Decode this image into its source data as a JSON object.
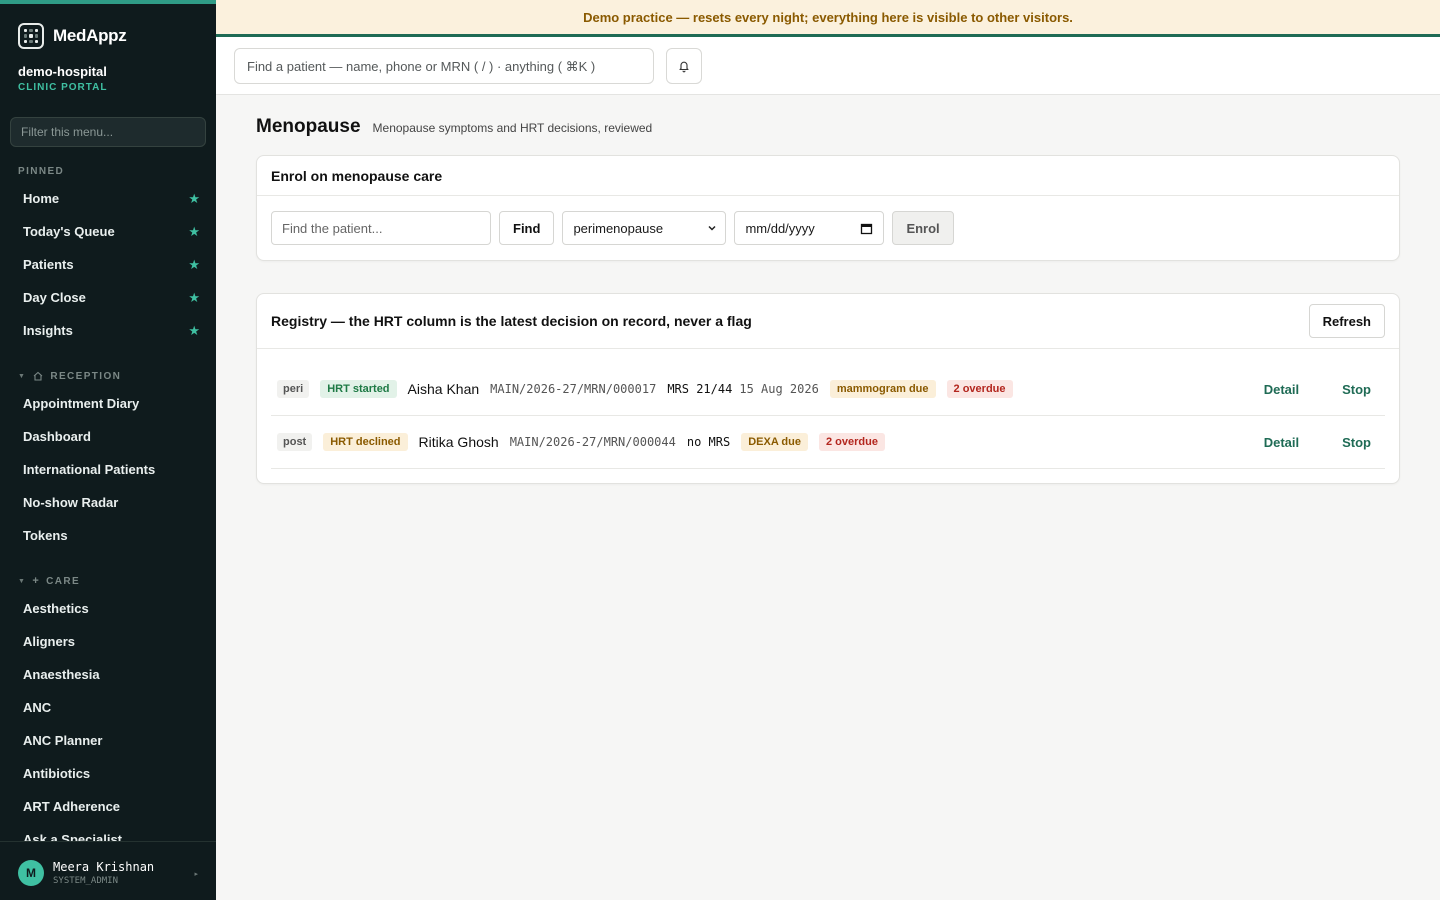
{
  "brand": {
    "name": "MedAppz"
  },
  "org": {
    "name": "demo-hospital",
    "sub": "CLINIC PORTAL"
  },
  "sidebar": {
    "filter_placeholder": "Filter this menu...",
    "pinned_label": "PINNED",
    "pinned": [
      {
        "label": "Home"
      },
      {
        "label": "Today's Queue"
      },
      {
        "label": "Patients"
      },
      {
        "label": "Day Close"
      },
      {
        "label": "Insights"
      }
    ],
    "reception_label": "RECEPTION",
    "reception": [
      {
        "label": "Appointment Diary"
      },
      {
        "label": "Dashboard"
      },
      {
        "label": "International Patients"
      },
      {
        "label": "No-show Radar"
      },
      {
        "label": "Tokens"
      }
    ],
    "care_label": "CARE",
    "care": [
      {
        "label": "Aesthetics"
      },
      {
        "label": "Aligners"
      },
      {
        "label": "Anaesthesia"
      },
      {
        "label": "ANC"
      },
      {
        "label": "ANC Planner"
      },
      {
        "label": "Antibiotics"
      },
      {
        "label": "ART Adherence"
      },
      {
        "label": "Ask a Specialist"
      }
    ]
  },
  "user": {
    "initial": "M",
    "name": "Meera Krishnan",
    "role": "SYSTEM_ADMIN"
  },
  "banner": {
    "text": "Demo practice — resets every night; everything here is visible to other visitors."
  },
  "topbar": {
    "search_placeholder": "Find a patient — name, phone or MRN ( / ) · anything ( ⌘K )"
  },
  "page": {
    "title": "Menopause",
    "subtitle": "Menopause symptoms and HRT decisions, reviewed"
  },
  "enrol": {
    "title": "Enrol on menopause care",
    "patient_placeholder": "Find the patient...",
    "find_label": "Find",
    "stage_value": "perimenopause",
    "date_placeholder": "mm/dd/yyyy",
    "enrol_label": "Enrol"
  },
  "registry": {
    "title": "Registry — the HRT column is the latest decision on record, never a flag",
    "refresh_label": "Refresh",
    "detail_label": "Detail",
    "stop_label": "Stop",
    "rows": [
      {
        "stage": "peri",
        "hrt": "HRT started",
        "name": "Aisha Khan",
        "mrn": "MAIN/2026-27/MRN/000017",
        "mrs": "MRS 21/44",
        "date": "15 Aug 2026",
        "due": "mammogram due",
        "overdue": "2 overdue"
      },
      {
        "stage": "post",
        "hrt": "HRT declined",
        "name": "Ritika Ghosh",
        "mrn": "MAIN/2026-27/MRN/000044",
        "mrs": "no MRS",
        "date": "",
        "due": "DEXA due",
        "overdue": "2 overdue"
      }
    ]
  },
  "colors": {
    "accent": "#1f6b55",
    "sidebar_bg": "#0f1b1d",
    "star": "#3fc0a2",
    "banner_bg": "#fbf1dd"
  },
  "icons": {
    "star": "star-icon",
    "bell": "bell-icon",
    "reception": "home-icon",
    "care": "plus-icon"
  }
}
